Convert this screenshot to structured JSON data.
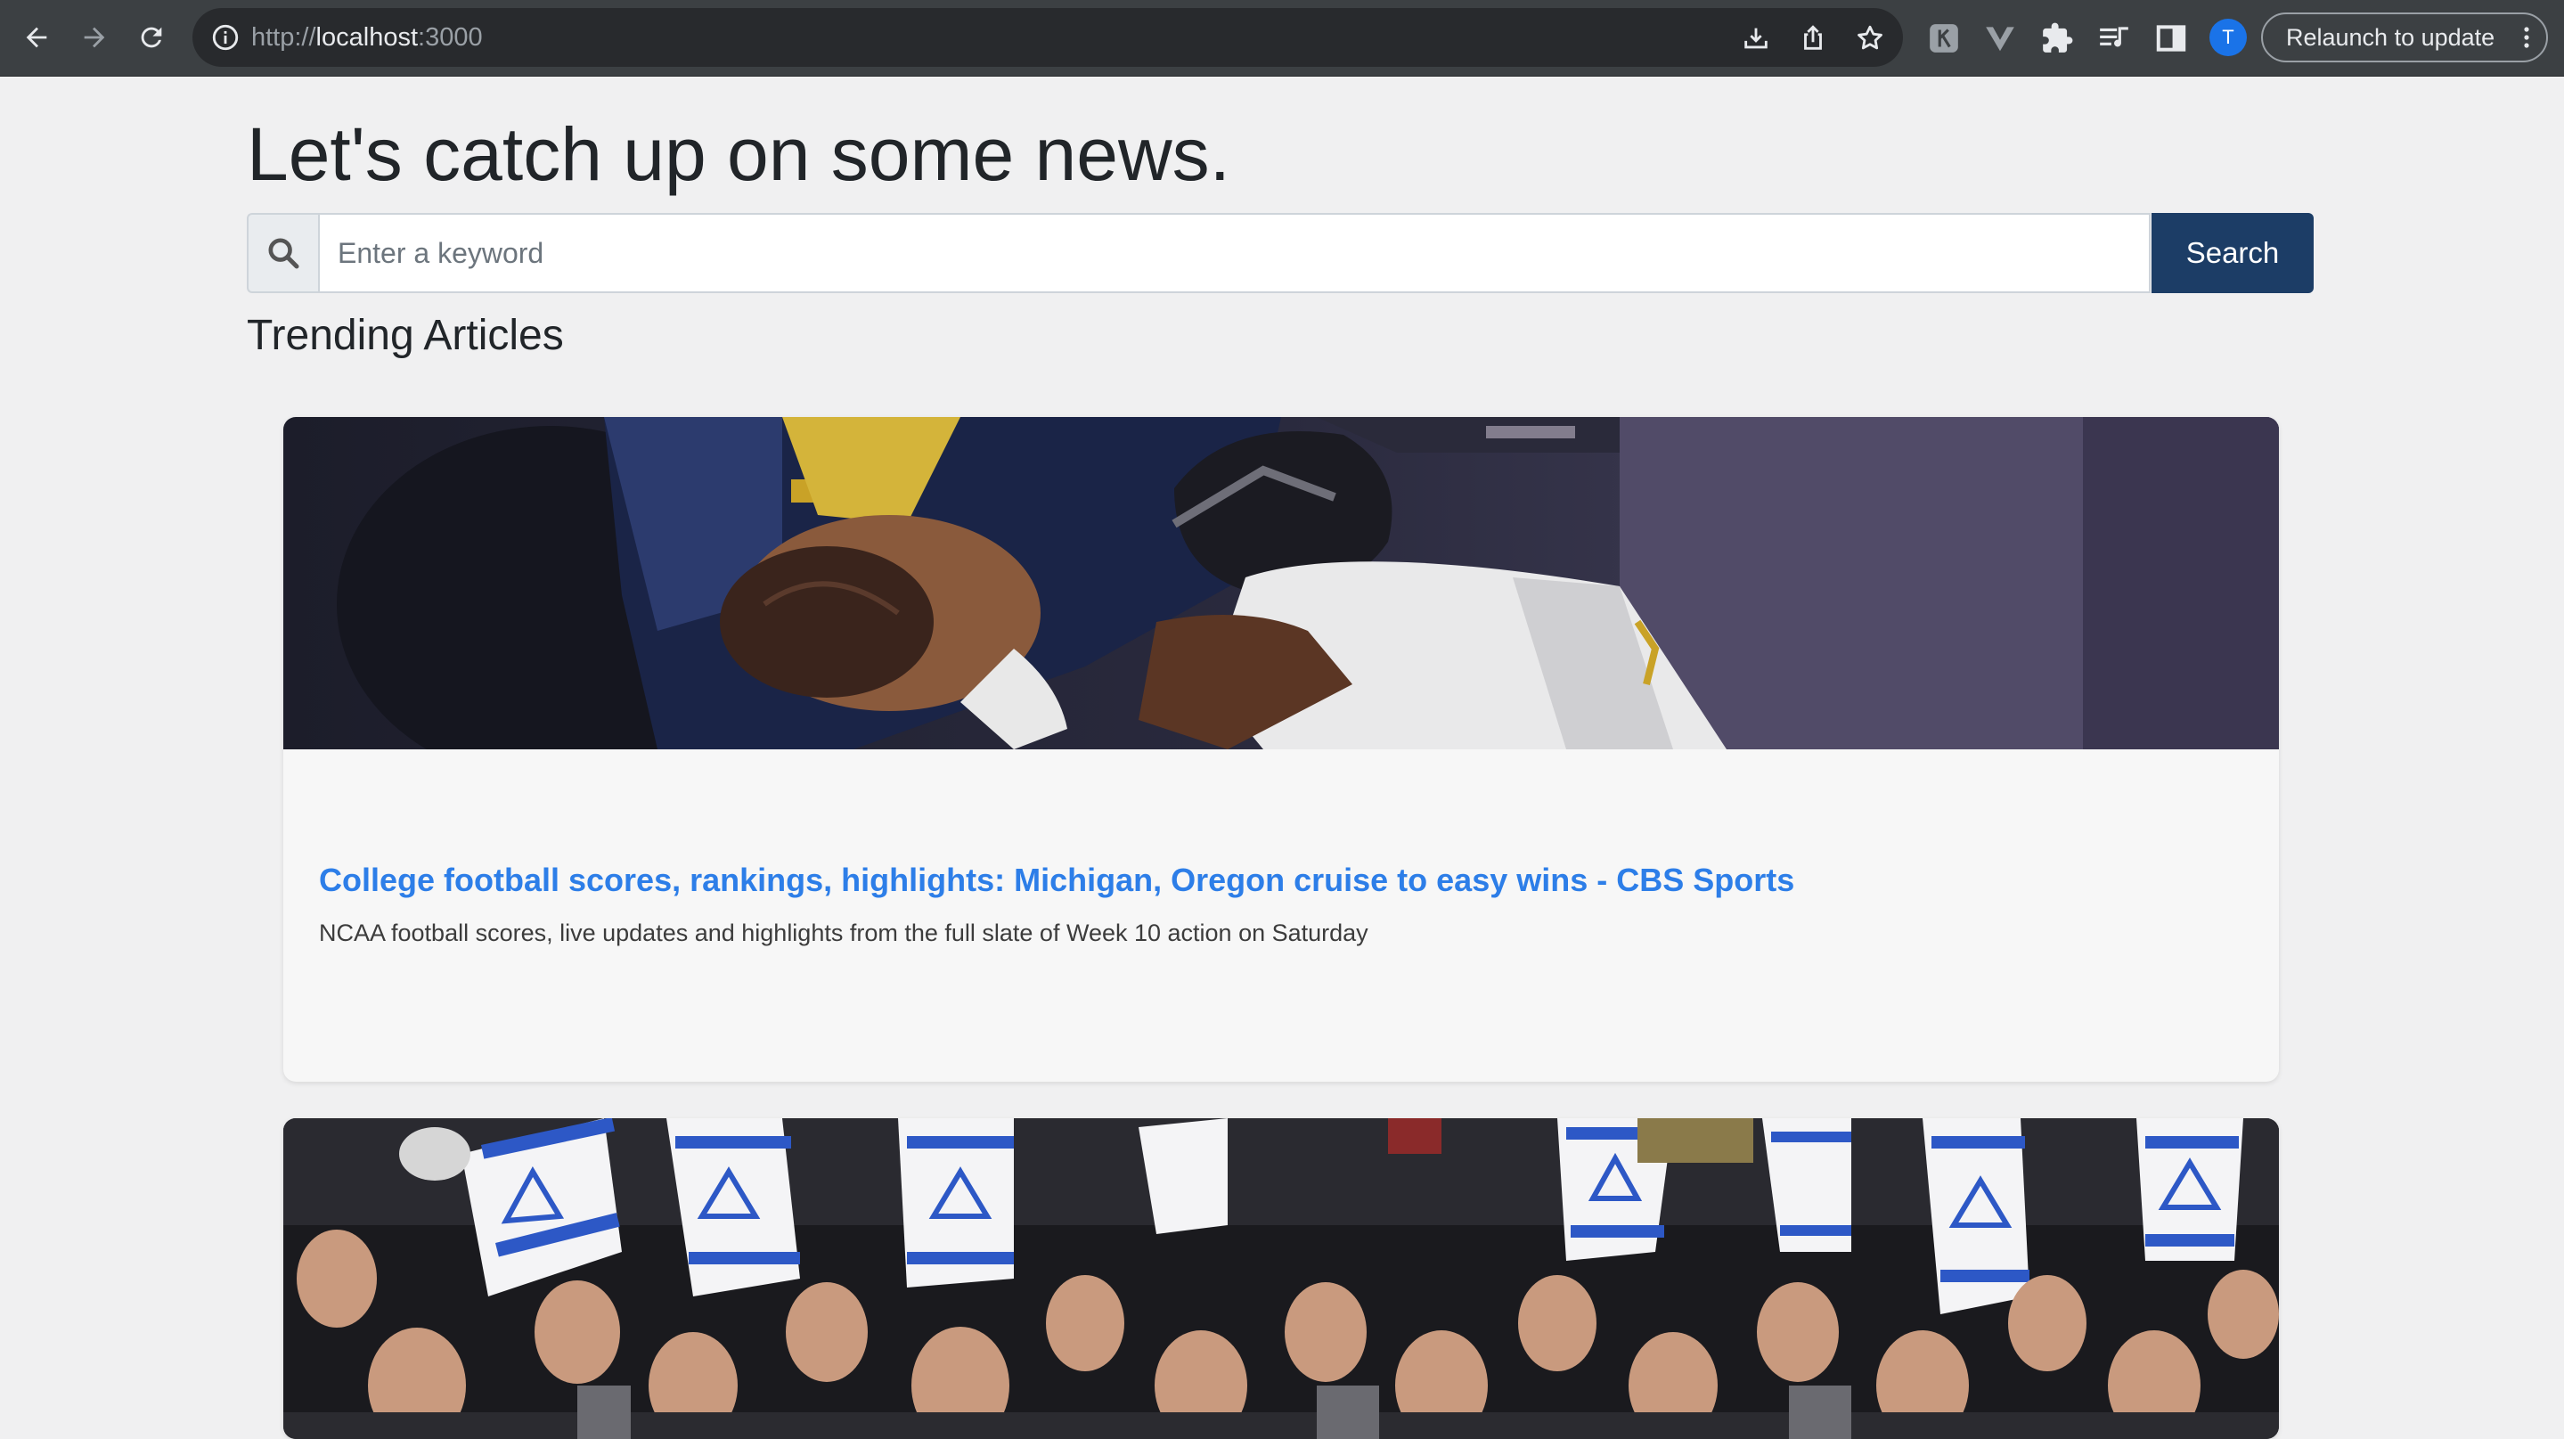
{
  "browser": {
    "url_scheme": "http://",
    "url_host": "localhost",
    "url_port": ":3000",
    "profile_initial": "T",
    "relaunch_label": "Relaunch to update",
    "icons": [
      "back-icon",
      "forward-icon",
      "reload-icon",
      "site-info-icon",
      "install-icon",
      "share-icon",
      "bookmark-star-icon",
      "extension-1-icon",
      "vue-devtools-icon",
      "extensions-puzzle-icon",
      "reading-list-icon",
      "side-panel-icon",
      "menu-dots-icon"
    ]
  },
  "page": {
    "headline": "Let's catch up on some news.",
    "search": {
      "placeholder": "Enter a keyword",
      "button_label": "Search"
    },
    "section_title": "Trending Articles",
    "articles": [
      {
        "title": "College football scores, rankings, highlights: Michigan, Oregon cruise to easy wins - CBS Sports",
        "description": "NCAA football scores, live updates and highlights from the full slate of Week 10 action on Saturday",
        "image": "football-action-photo"
      },
      {
        "title": "",
        "description": "",
        "image": "protest-crowd-with-flags-photo"
      }
    ]
  },
  "colors": {
    "chrome_bg": "#3c4043",
    "page_bg": "#f0f0f1",
    "search_button": "#1c3d66",
    "article_link": "#2d7ee8",
    "avatar": "#1a73e8"
  }
}
